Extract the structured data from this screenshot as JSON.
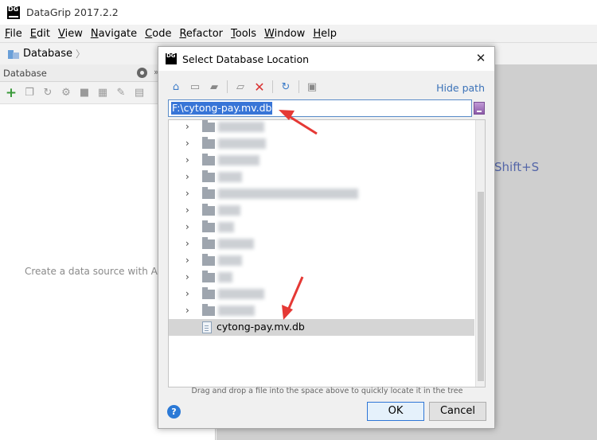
{
  "app": {
    "logo_text": "DG",
    "title": "DataGrip 2017.2.2"
  },
  "menu": [
    {
      "underline": "F",
      "rest": "ile"
    },
    {
      "underline": "E",
      "rest": "dit"
    },
    {
      "underline": "V",
      "rest": "iew"
    },
    {
      "underline": "N",
      "rest": "avigate"
    },
    {
      "underline": "C",
      "rest": "ode"
    },
    {
      "underline": "R",
      "rest": "efactor"
    },
    {
      "underline": "T",
      "rest": "ools"
    },
    {
      "underline": "W",
      "rest": "indow"
    },
    {
      "underline": "H",
      "rest": "elp"
    }
  ],
  "navbar": {
    "breadcrumb": "Database"
  },
  "left_panel": {
    "header": "Database",
    "pin_glyph": "»",
    "empty_text": "Create a data source with Alt"
  },
  "right_area": {
    "shortcut_hint": "Shift+S"
  },
  "dialog": {
    "logo_text": "DG",
    "title": "Select Database Location",
    "close_glyph": "✕",
    "hide_path": "Hide path",
    "path_value": "F:\\cytong-pay.mv.db",
    "tree": {
      "folder_rows": 12,
      "selected_file": "cytong-pay.mv.db"
    },
    "drag_hint": "Drag and drop a file into the space above to quickly locate it in the tree",
    "help_glyph": "?",
    "ok_label": "OK",
    "cancel_label": "Cancel"
  },
  "colors": {
    "selection": "#3875d7",
    "link": "#3b72b8",
    "annotation_arrow": "#e53935"
  }
}
